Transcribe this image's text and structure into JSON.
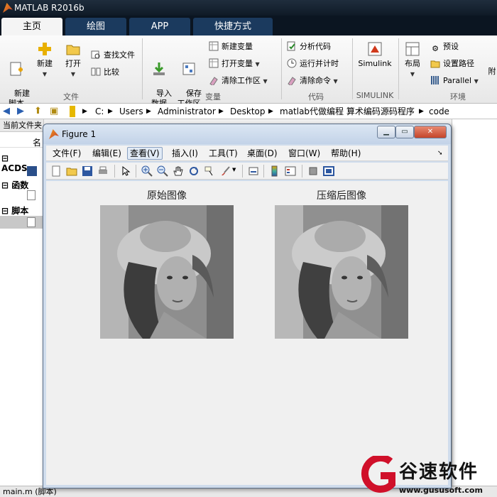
{
  "app": {
    "title": "MATLAB R2016b"
  },
  "ribbon_tabs": [
    "主页",
    "绘图",
    "APP",
    "快捷方式"
  ],
  "ribbon": {
    "file": {
      "new_script": "新建\n脚本",
      "new": "新建",
      "open": "打开",
      "find_files": "查找文件",
      "compare": "比较",
      "label": "文件"
    },
    "variable": {
      "import": "导入\n数据",
      "save_ws": "保存\n工作区",
      "new_var": "新建变量",
      "open_var": "打开变量",
      "clear_ws": "清除工作区",
      "label": "变量"
    },
    "code": {
      "analyze": "分析代码",
      "run_time": "运行并计时",
      "clear_cmd": "清除命令",
      "label": "代码"
    },
    "simulink": {
      "btn": "Simulink",
      "label": "SIMULINK"
    },
    "env": {
      "layout": "布局",
      "prefs": "预设",
      "set_path": "设置路径",
      "parallel": "Parallel",
      "label": "环境",
      "more": "附"
    }
  },
  "address": {
    "c": "C:",
    "p1": "Users",
    "p2": "Administrator",
    "p3": "Desktop",
    "p4": "matlab代做编程 算术编码源码程序",
    "p5": "code"
  },
  "left_panel": {
    "header": "当前文件夹",
    "name_col": "名",
    "acd": "ACDSe",
    "func": "函数",
    "script": "脚本"
  },
  "status": {
    "file": "main.m  (脚本)"
  },
  "figure": {
    "title": "Figure 1",
    "menu": [
      "文件(F)",
      "编辑(E)",
      "查看(V)",
      "插入(I)",
      "工具(T)",
      "桌面(D)",
      "窗口(W)",
      "帮助(H)"
    ],
    "axes": [
      {
        "title": "原始图像"
      },
      {
        "title": "压缩后图像"
      }
    ]
  },
  "watermark": {
    "brand": "谷速软件",
    "url": "www.gususoft.com"
  }
}
